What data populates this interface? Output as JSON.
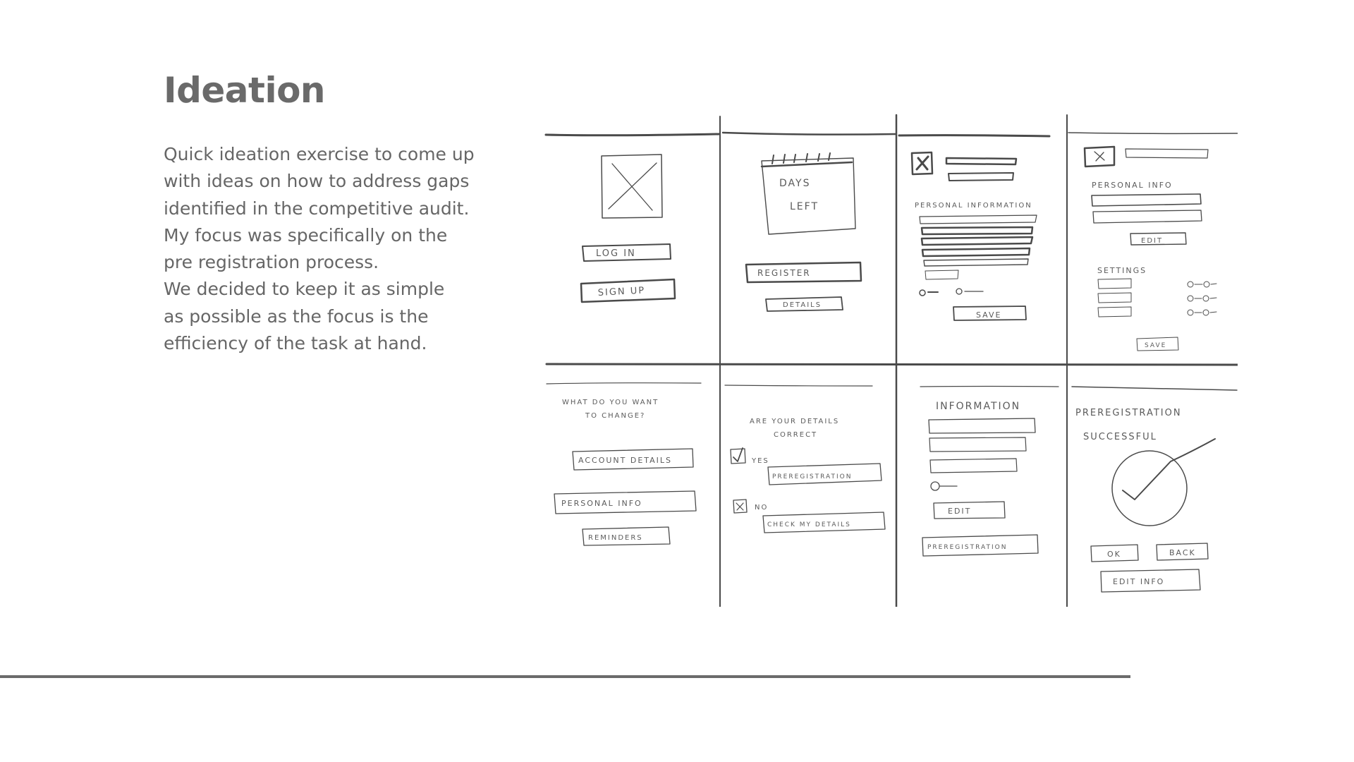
{
  "slide": {
    "title": "Ideation",
    "paragraph_lines": [
      "Quick ideation exercise to come up",
      "with ideas on how to address gaps",
      "identified in the competitive audit.",
      "My focus was specifically on the",
      "pre registration process.",
      "We decided to keep it as simple",
      "as possible as the focus is the",
      "efficiency of the task at hand."
    ]
  },
  "sketches": {
    "screen_1": {
      "login": "LOG IN",
      "signup": "SIGN UP"
    },
    "screen_2": {
      "days": "DAYS",
      "left": "LEFT",
      "register": "REGISTER",
      "details": "DETAILS"
    },
    "screen_3": {
      "heading": "PERSONAL INFORMATION",
      "save": "SAVE"
    },
    "screen_4": {
      "heading": "PERSONAL INFO",
      "edit": "EDIT",
      "settings": "SETTINGS",
      "save": "SAVE"
    },
    "screen_5": {
      "q1": "WHAT DO YOU WANT",
      "q2": "TO CHANGE?",
      "account": "ACCOUNT DETAILS",
      "personal": "PERSONAL INFO",
      "reminders": "REMINDERS"
    },
    "screen_6": {
      "q1": "ARE YOUR DETAILS",
      "q2": "CORRECT",
      "yes": "YES",
      "prereg": "PREREGISTRATION",
      "no": "NO",
      "check": "CHECK MY DETAILS"
    },
    "screen_7": {
      "heading": "INFORMATION",
      "edit": "EDIT",
      "prereg": "PREREGISTRATION"
    },
    "screen_8": {
      "l1": "PREREGISTRATION",
      "l2": "SUCCESSFUL",
      "ok": "OK",
      "back": "BACK",
      "edit_info": "EDIT INFO"
    }
  },
  "colors": {
    "text": "#666666",
    "pencil": "#4a4a4a",
    "rule": "#6b6b6b"
  }
}
